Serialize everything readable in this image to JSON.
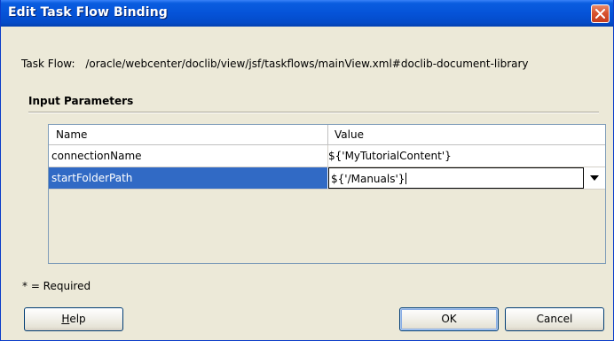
{
  "window": {
    "title": "Edit Task Flow Binding"
  },
  "task_flow": {
    "label": "Task Flow:",
    "value": "/oracle/webcenter/doclib/view/jsf/taskflows/mainView.xml#doclib-document-library"
  },
  "input_parameters": {
    "section_title": "Input Parameters",
    "columns": [
      "Name",
      "Value"
    ],
    "rows": [
      {
        "name": "connectionName",
        "value": "${'MyTutorialContent'}"
      },
      {
        "name": "startFolderPath",
        "value": "${'/Manuals'}"
      }
    ],
    "selected_row": 1
  },
  "required_note": "* = Required",
  "buttons": {
    "help": {
      "label_first": "H",
      "label_rest": "elp"
    },
    "ok": "OK",
    "cancel": "Cancel"
  },
  "icons": {
    "close": "close-icon",
    "dropdown": "chevron-down-icon"
  },
  "colors": {
    "titlebar": "#0553d8",
    "selection": "#316ac5",
    "dialog_background": "#ece9d8"
  }
}
